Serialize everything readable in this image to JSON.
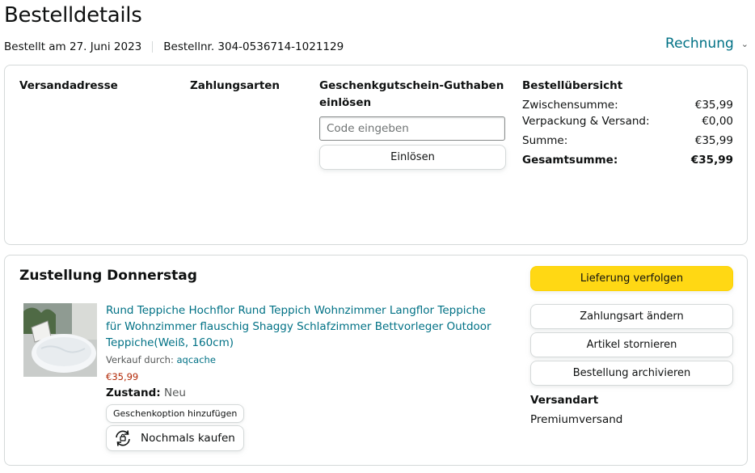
{
  "header": {
    "title": "Bestelldetails",
    "ordered_on": "Bestellt am 27. Juni 2023",
    "order_number": "Bestellnr. 304-0536714-1021129",
    "invoice_label": "Rechnung"
  },
  "summary_card": {
    "shipping_address_label": "Versandadresse",
    "payment_methods_label": "Zahlungsarten",
    "gift_card_label_line1": "Geschenkgutschein-Guthaben",
    "gift_card_label_line2": "einlösen",
    "code_placeholder": "Code eingeben",
    "redeem_label": "Einlösen",
    "order_summary_label": "Bestellübersicht",
    "rows": [
      {
        "label": "Zwischensumme:",
        "value": "€35,99"
      },
      {
        "label": "Verpackung & Versand:",
        "value": "€0,00"
      },
      {
        "label": "Summe:",
        "value": "€35,99"
      },
      {
        "label": "Gesamtsumme:",
        "value": "€35,99"
      }
    ]
  },
  "delivery": {
    "title": "Zustellung Donnerstag",
    "product": {
      "title": "Rund Teppiche Hochflor Rund Teppich Wohnzimmer Langflor Teppiche für Wohnzimmer flauschig Shaggy Schlafzimmer Bettvorleger Outdoor Teppiche(Weiß, 160cm)",
      "sold_by_label": "Verkauf durch: ",
      "seller": "aqcache",
      "price": "€35,99",
      "condition_label": "Zustand:",
      "condition_value": "Neu",
      "gift_option_label": "Geschenkoption hinzufügen",
      "buy_again_label": "Nochmals kaufen"
    },
    "actions": {
      "track": "Lieferung verfolgen",
      "change_payment": "Zahlungsart ändern",
      "cancel": "Artikel stornieren",
      "archive": "Bestellung archivieren"
    },
    "shipping_method_label": "Versandart",
    "shipping_method_value": "Premiumversand"
  },
  "colors": {
    "link": "#007185",
    "price": "#b12704",
    "primary_button": "#ffd814",
    "border": "#d5d9d9"
  },
  "icons": [
    "chevron-down-icon",
    "buy-again-icon"
  ]
}
